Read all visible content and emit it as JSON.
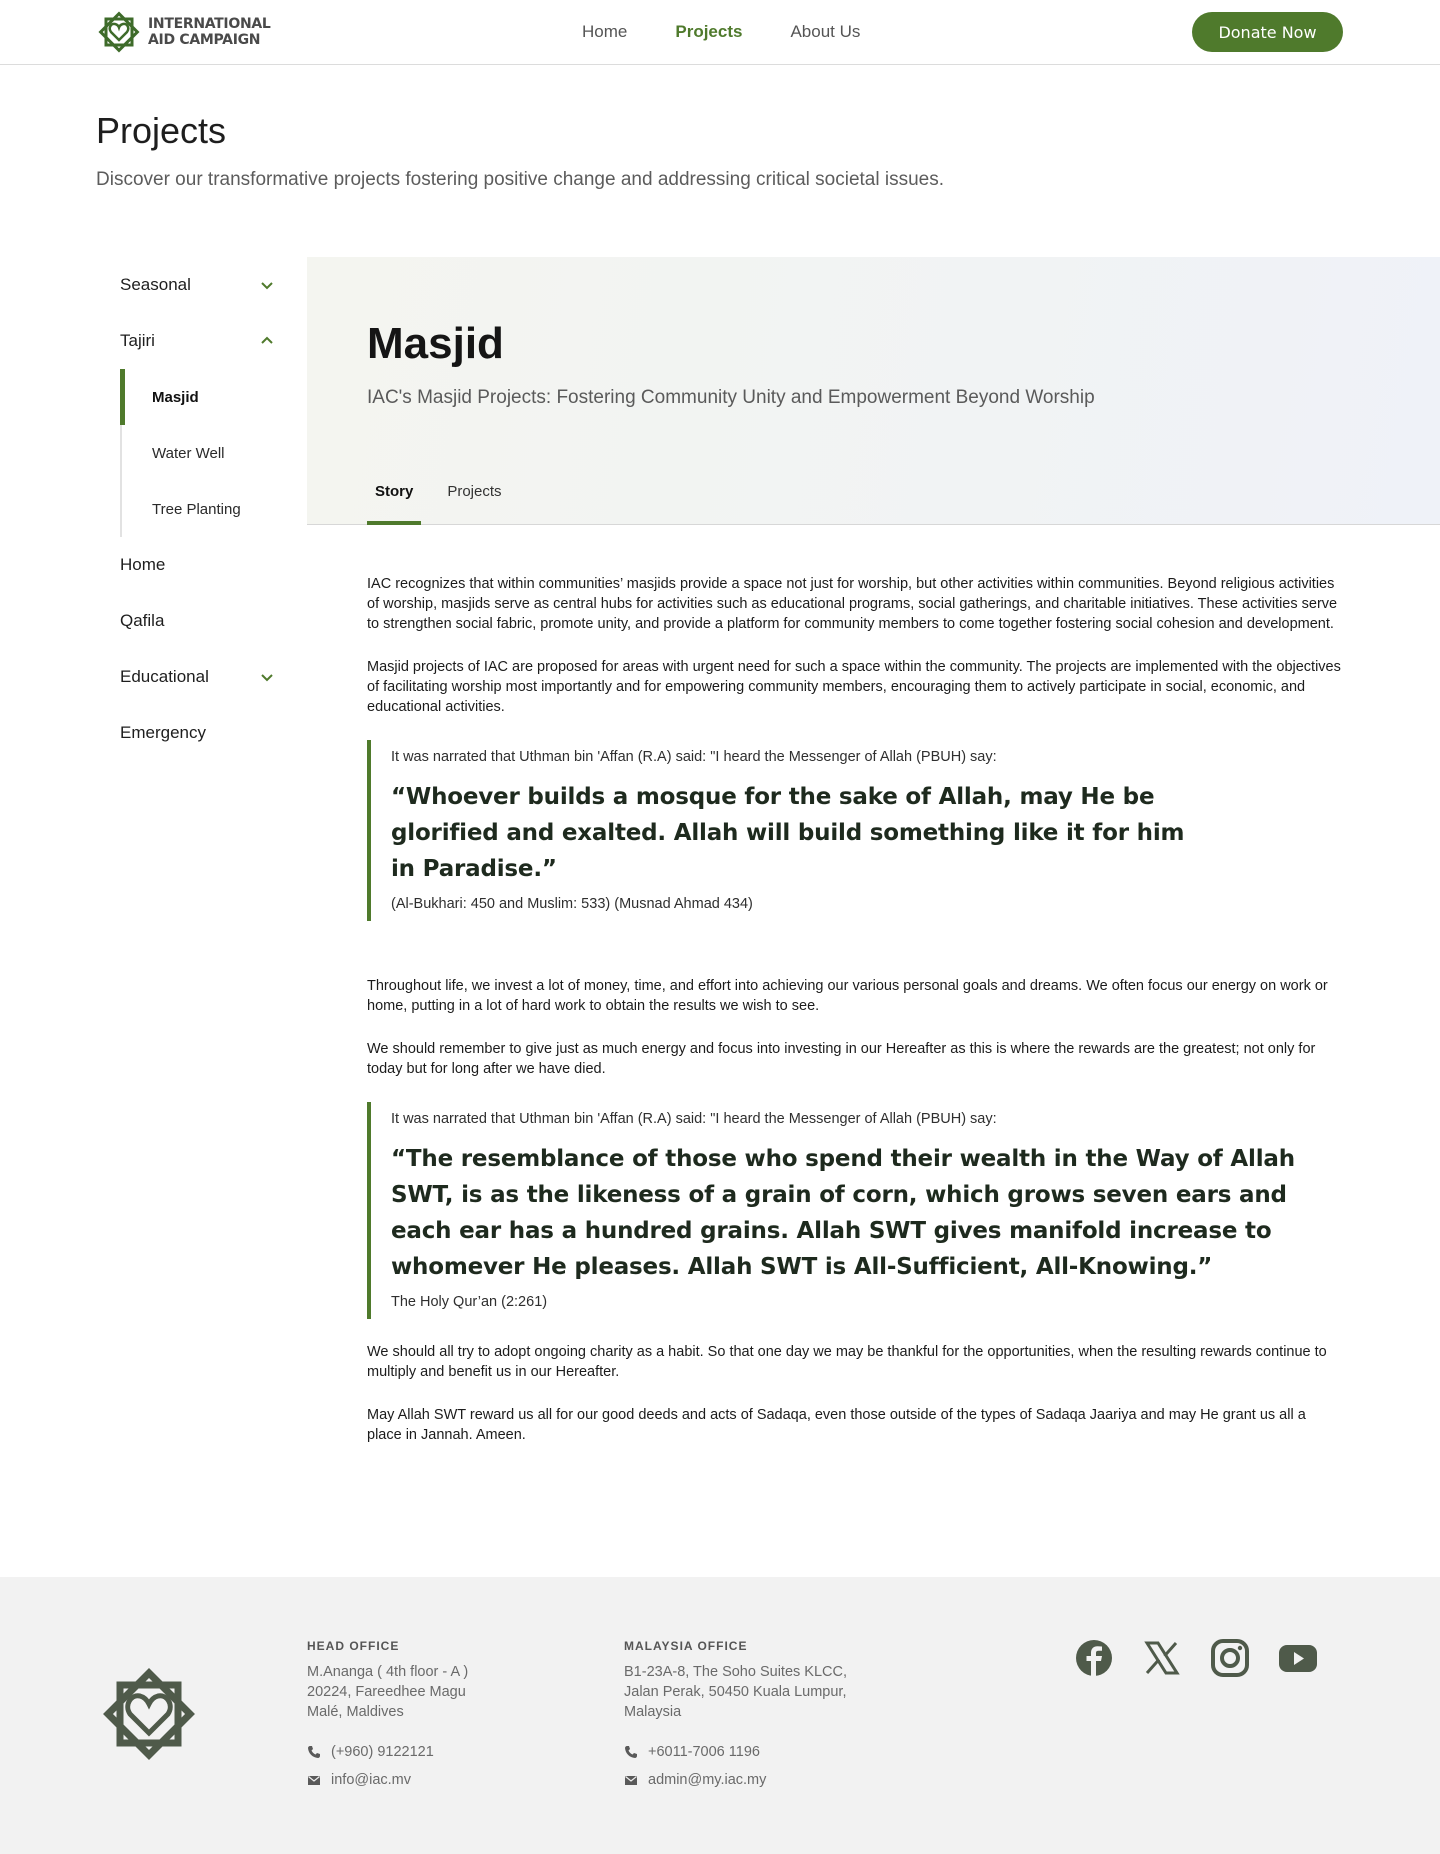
{
  "header": {
    "logo_line1": "INTERNATIONAL",
    "logo_line2": "AID CAMPAIGN",
    "nav": [
      "Home",
      "Projects",
      "About Us"
    ],
    "active_nav": "Projects",
    "donate_label": "Donate Now"
  },
  "page": {
    "title": "Projects",
    "subtitle": "Discover our transformative projects fostering positive change and addressing critical societal issues."
  },
  "sidebar": {
    "seasonal": "Seasonal",
    "tajiri": "Tajiri",
    "tajiri_items": [
      "Masjid",
      "Water Well",
      "Tree Planting"
    ],
    "home": "Home",
    "qafila": "Qafila",
    "educational": "Educational",
    "emergency": "Emergency"
  },
  "hero": {
    "title": "Masjid",
    "subtitle": "IAC's Masjid Projects: Fostering Community Unity and Empowerment Beyond Worship",
    "tabs": [
      "Story",
      "Projects"
    ]
  },
  "article": {
    "p1": "IAC recognizes that within communities’ masjids provide a space not just for worship, but other activities within communities. Beyond religious activities of worship, masjids serve as central hubs for activities such as educational programs, social gatherings, and charitable initiatives. These activities serve to strengthen social fabric, promote unity, and provide a platform for community members to come together fostering social cohesion and development.",
    "p2": "Masjid projects of IAC are proposed for areas with urgent need for such a space within the community. The projects are implemented with the objectives of facilitating worship most importantly and for empowering community members, encouraging them to actively participate in social, economic, and educational activities.",
    "quote1": {
      "intro": "It was narrated that Uthman bin 'Affan (R.A) said: \"I heard the Messenger of Allah (PBUH) say:",
      "text": "“Whoever builds a mosque for the sake of Allah, may He be glorified and exalted. Allah will build something like it for him in Paradise.”",
      "cite": "(Al-Bukhari: 450 and Muslim: 533) (Musnad Ahmad 434)"
    },
    "p3": "Throughout life, we invest a lot of money, time, and effort into achieving our various personal goals and dreams. We often focus our energy on work or home, putting in a lot of hard work to obtain the results we wish to see.",
    "p4": "We should remember to give just as much energy and focus into investing in our Hereafter as this is where the rewards are the greatest; not only for today but for long after we have died.",
    "quote2": {
      "intro": "It was narrated that Uthman bin 'Affan (R.A) said: \"I heard the Messenger of Allah (PBUH) say:",
      "text": "“The resemblance of those who spend their wealth in the Way of Allah SWT, is as the likeness of a grain of corn, which grows seven ears and each ear has a hundred grains. Allah SWT gives manifold increase to whomever He pleases. Allah SWT is All-Sufficient, All-Knowing.”",
      "cite": "The Holy Qur’an (2:261)"
    },
    "p5": "We should all try to adopt ongoing charity as a habit. So that one day we may be thankful for the opportunities, when the resulting rewards continue to multiply and benefit us in our Hereafter.",
    "p6": "May Allah SWT reward us all for our good deeds and acts of Sadaqa, even those outside of the types of Sadaqa Jaariya and may He grant us all a place in Jannah. Ameen."
  },
  "footer": {
    "head_office": {
      "heading": "HEAD OFFICE",
      "address": [
        "M.Ananga ( 4th floor - A )",
        "20224, Fareedhee Magu",
        "Malé, Maldives"
      ],
      "phone": "(+960) 9122121",
      "email": "info@iac.mv"
    },
    "malaysia_office": {
      "heading": "MALAYSIA OFFICE",
      "address": [
        "B1-23A-8, The Soho Suites KLCC,",
        "Jalan Perak, 50450 Kuala Lumpur,",
        "Malaysia"
      ],
      "phone": "+6011-7006 1196",
      "email": "admin@my.iac.my"
    },
    "socials": [
      "facebook-icon",
      "x-icon",
      "instagram-icon",
      "youtube-icon"
    ]
  },
  "colors": {
    "brand_green": "#4f7a2c",
    "logo_green": "#3e6b2a",
    "footer_bg": "#f2f2f2"
  }
}
